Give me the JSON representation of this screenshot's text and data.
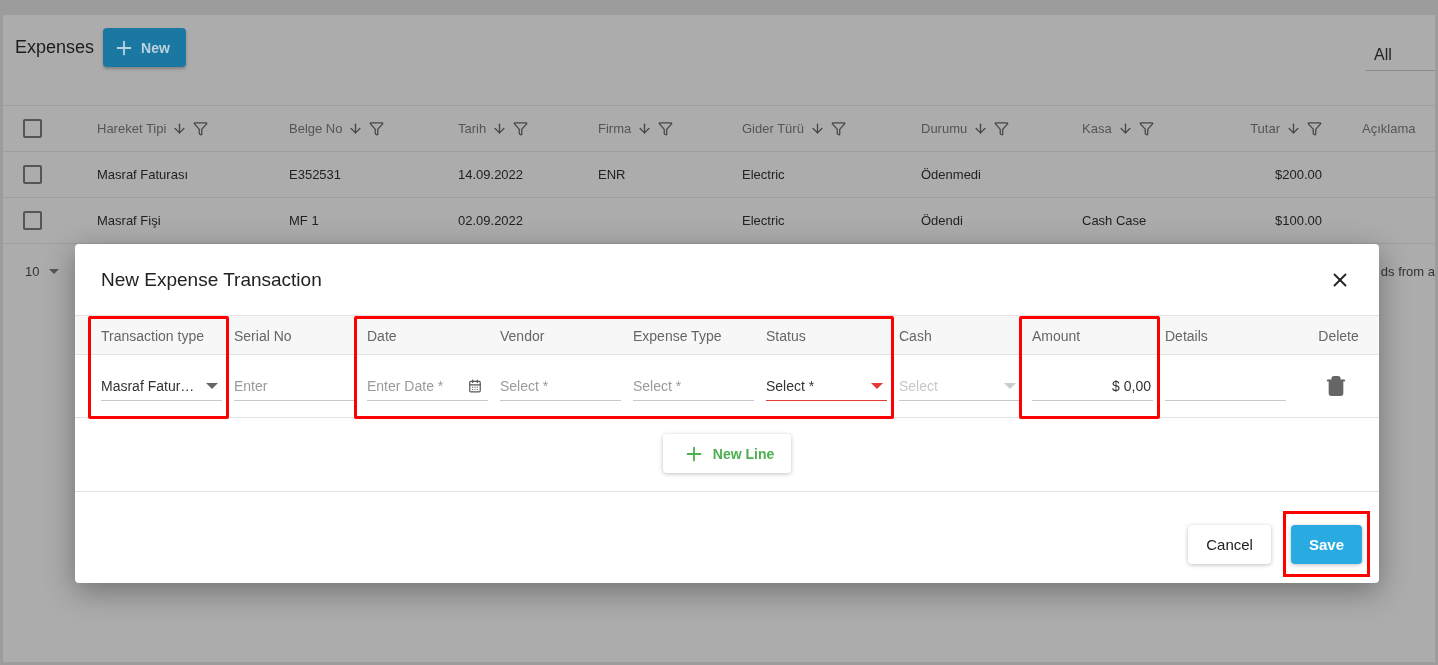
{
  "page": {
    "title": "Expenses",
    "new_button": "New",
    "filter_select": {
      "value": "All"
    }
  },
  "table": {
    "header_checkbox": {
      "checked": false
    },
    "columns": [
      {
        "label": "Hareket Tipi",
        "sortable": true,
        "kind": "text"
      },
      {
        "label": "Belge No",
        "sortable": true,
        "kind": "text"
      },
      {
        "label": "Tarih",
        "sortable": true,
        "kind": "text"
      },
      {
        "label": "Firma",
        "sortable": true,
        "kind": "text"
      },
      {
        "label": "Gider Türü",
        "sortable": true,
        "kind": "text"
      },
      {
        "label": "Durumu",
        "sortable": true,
        "kind": "text"
      },
      {
        "label": "Kasa",
        "sortable": true,
        "kind": "text"
      },
      {
        "label": "Tutar",
        "sortable": true,
        "kind": "amount"
      },
      {
        "label": "Açıklama",
        "sortable": false,
        "kind": "text"
      }
    ],
    "rows": [
      {
        "checked": false,
        "cells": [
          "Masraf Faturası",
          "E352531",
          "14.09.2022",
          "ENR",
          "Electric",
          "Ödenmedi",
          "",
          "$200.00",
          ""
        ]
      },
      {
        "checked": false,
        "cells": [
          "Masraf Fişi",
          "MF 1",
          "02.09.2022",
          "",
          "Electric",
          "Ödendi",
          "Cash Case",
          "$100.00",
          ""
        ]
      }
    ],
    "pagination": {
      "page_size": "10",
      "summary": "ds from a"
    }
  },
  "dialog": {
    "title": "New Expense Transaction",
    "columns": [
      {
        "label": "Transaction type",
        "highlighted": true,
        "field": {
          "kind": "select",
          "value": "Masraf Fatur…"
        }
      },
      {
        "label": "Serial No",
        "highlighted": false,
        "field": {
          "kind": "text",
          "placeholder": "Enter"
        }
      },
      {
        "label": "Date",
        "highlighted": true,
        "field": {
          "kind": "date",
          "placeholder": "Enter Date *"
        }
      },
      {
        "label": "Vendor",
        "highlighted": true,
        "field": {
          "kind": "text",
          "placeholder": "Select *"
        }
      },
      {
        "label": "Expense Type",
        "highlighted": true,
        "field": {
          "kind": "text",
          "placeholder": "Select *"
        }
      },
      {
        "label": "Status",
        "highlighted": true,
        "field": {
          "kind": "select",
          "placeholder": "Select *",
          "error": true
        }
      },
      {
        "label": "Cash",
        "highlighted": false,
        "field": {
          "kind": "select",
          "placeholder": "Select",
          "disabled": true
        }
      },
      {
        "label": "Amount",
        "highlighted": true,
        "field": {
          "kind": "currency",
          "value": "$ 0,00"
        }
      },
      {
        "label": "Details",
        "highlighted": false,
        "field": {
          "kind": "text"
        }
      },
      {
        "label": "Delete",
        "highlighted": false,
        "field": {
          "kind": "delete"
        }
      }
    ],
    "new_line_button": "New Line",
    "buttons": [
      {
        "label": "Cancel",
        "kind": "secondary",
        "highlighted": false
      },
      {
        "label": "Save",
        "kind": "primary",
        "highlighted": true
      }
    ]
  }
}
